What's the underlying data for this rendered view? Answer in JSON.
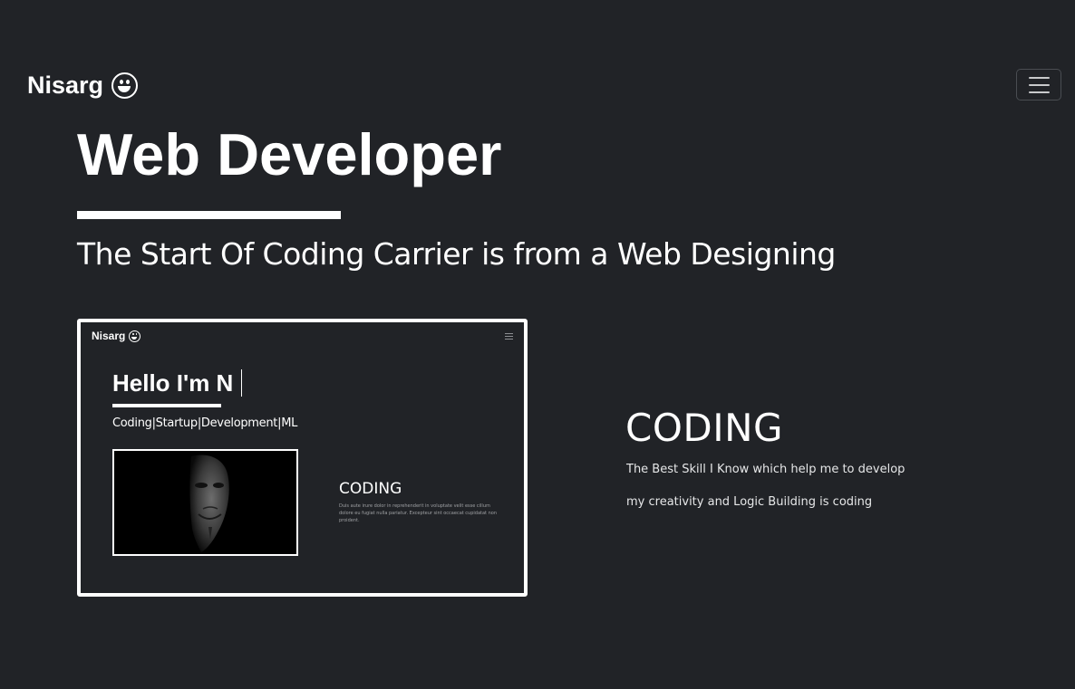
{
  "navbar": {
    "brand": "Nisarg",
    "brand_icon": "grinning-face-icon",
    "toggle_icon": "hamburger-menu-icon"
  },
  "hero": {
    "title": "Web Developer",
    "subtitle": "The Start Of Coding Carrier is from a Web Designing"
  },
  "preview": {
    "brand": "Nisarg",
    "hello": "Hello I'm  N",
    "skills": "Coding|Startup|Development|ML",
    "image_icon": "anonymous-mask-image",
    "coding_title": "CODING",
    "coding_desc": "Duis aute irure dolor in reprehenderit in voluptate velit esse cillum dolore eu fugiat nulla pariatur. Excepteur sint occaecat cupidatat non proident."
  },
  "coding": {
    "title": "CODING",
    "line1": "The Best Skill I Know which help me to develop",
    "line2": "my creativity and Logic Building is coding"
  },
  "colors": {
    "background": "#212327",
    "text": "#ffffff",
    "border": "#ffffff"
  }
}
